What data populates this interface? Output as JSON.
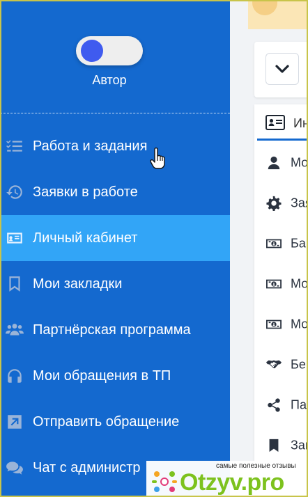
{
  "sidebar": {
    "role": {
      "label": "Автор",
      "toggle_on": false
    },
    "items": [
      {
        "label": "Работа и задания",
        "icon": "list-check-icon",
        "active": false
      },
      {
        "label": "Заявки в работе",
        "icon": "history-icon",
        "active": false
      },
      {
        "label": "Личный кабинет",
        "icon": "id-card-icon",
        "active": true
      },
      {
        "label": "Мои закладки",
        "icon": "bookmark-icon",
        "active": false
      },
      {
        "label": "Партнёрская программа",
        "icon": "users-icon",
        "active": false
      },
      {
        "label": "Мои обращения в ТП",
        "icon": "headphones-icon",
        "active": false
      },
      {
        "label": "Отправить обращение",
        "icon": "external-link-icon",
        "active": false
      },
      {
        "label": "Чат с администр",
        "icon": "chat-icon",
        "active": false
      }
    ]
  },
  "right_panel": {
    "tab_label": "Ин",
    "items": [
      {
        "label": "Мо",
        "icon": "user-icon"
      },
      {
        "label": "Зая",
        "icon": "gear-icon"
      },
      {
        "label": "Ба",
        "icon": "money-icon"
      },
      {
        "label": "Мо",
        "icon": "money-icon"
      },
      {
        "label": "Мо",
        "icon": "money-icon"
      },
      {
        "label": "Бе",
        "icon": "handshake-icon"
      },
      {
        "label": "Па",
        "icon": "share-icon"
      },
      {
        "label": "Зак",
        "icon": "bookmark-icon"
      }
    ]
  },
  "watermark": {
    "caption": "самые полезные отзывы",
    "text": "Otzyv.pro"
  },
  "colors": {
    "sidebar_bg": "#1469cf",
    "active_item_bg": "#32a5f7",
    "toggle_knob": "#3f5bef",
    "watermark_green": "#7dc21e"
  }
}
